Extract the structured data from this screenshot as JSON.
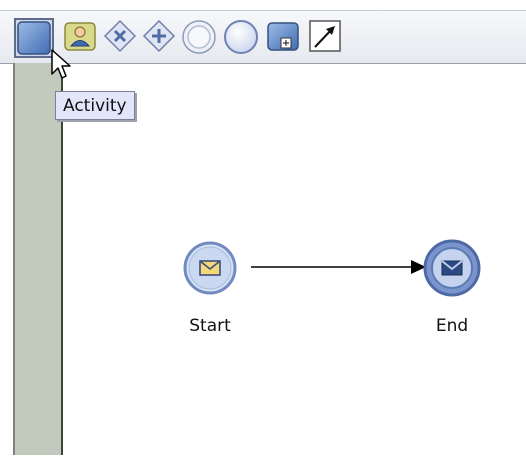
{
  "toolbar": {
    "tools": [
      {
        "name": "activity-tool-icon",
        "tooltip": "Activity"
      },
      {
        "name": "user-task-tool-icon"
      },
      {
        "name": "exclusive-gateway-tool-icon"
      },
      {
        "name": "parallel-gateway-tool-icon"
      },
      {
        "name": "intermediate-event-tool-icon"
      },
      {
        "name": "end-event-tool-icon"
      },
      {
        "name": "subprocess-tool-icon"
      },
      {
        "name": "connector-tool-icon"
      }
    ]
  },
  "tooltip": {
    "text": "Activity"
  },
  "diagram": {
    "start": {
      "label": "Start"
    },
    "end": {
      "label": "End"
    }
  },
  "colors": {
    "panel": "#c1cabd",
    "node_fill": "#c7d6ef",
    "node_border": "#6f8bc0",
    "end_fill": "#5b7fc0"
  }
}
